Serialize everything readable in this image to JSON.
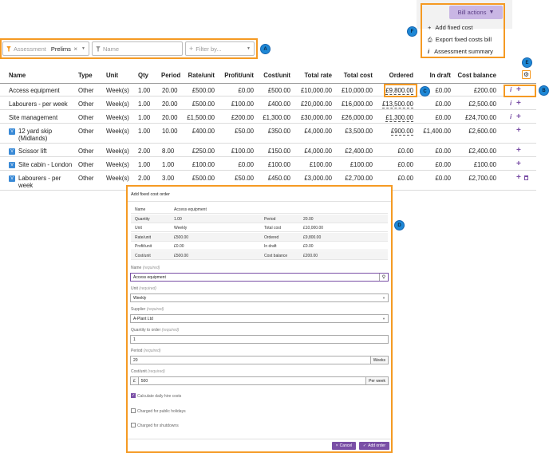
{
  "bill_actions": {
    "button_label": "Bill actions",
    "items": [
      {
        "icon": "plus-icon",
        "label": "Add fixed cost"
      },
      {
        "icon": "print-icon",
        "label": "Export fixed costs bill"
      },
      {
        "icon": "info-icon",
        "label": "Assessment summary"
      }
    ]
  },
  "filters": {
    "assessment_label": "Assessment",
    "assessment_value": "Prelims",
    "name_placeholder": "Name",
    "filter_by_placeholder": "Filter by..."
  },
  "callouts": [
    "A",
    "B",
    "C",
    "D",
    "E",
    "F"
  ],
  "table": {
    "columns": [
      "Name",
      "Type",
      "Unit",
      "Qty",
      "Period",
      "Rate/unit",
      "Profit/unit",
      "Cost/unit",
      "Total rate",
      "Total cost",
      "Ordered",
      "In draft",
      "Cost balance"
    ],
    "rows": [
      {
        "name": "Access equipment",
        "type": "Other",
        "unit": "Week(s)",
        "qty": "1.00",
        "period": "20.00",
        "rate": "£500.00",
        "profit": "£0.00",
        "cost": "£500.00",
        "total_rate": "£10,000.00",
        "total_cost": "£10,000.00",
        "ordered": "£9,800.00",
        "draft": "£0.00",
        "balance": "£200.00"
      },
      {
        "name": "Labourers - per week",
        "type": "Other",
        "unit": "Week(s)",
        "qty": "1.00",
        "period": "20.00",
        "rate": "£500.00",
        "profit": "£100.00",
        "cost": "£400.00",
        "total_rate": "£20,000.00",
        "total_cost": "£16,000.00",
        "ordered": "£13,500.00",
        "draft": "£0.00",
        "balance": "£2,500.00"
      },
      {
        "name": "Site management",
        "type": "Other",
        "unit": "Week(s)",
        "qty": "1.00",
        "period": "20.00",
        "rate": "£1,500.00",
        "profit": "£200.00",
        "cost": "£1,300.00",
        "total_rate": "£30,000.00",
        "total_cost": "£26,000.00",
        "ordered": "£1,300.00",
        "draft": "£0.00",
        "balance": "£24,700.00"
      },
      {
        "name": "12 yard skip (Midlands)",
        "type": "Other",
        "unit": "Week(s)",
        "qty": "1.00",
        "period": "10.00",
        "rate": "£400.00",
        "profit": "£50.00",
        "cost": "£350.00",
        "total_rate": "£4,000.00",
        "total_cost": "£3,500.00",
        "ordered": "£900.00",
        "draft": "£1,400.00",
        "balance": "£2,600.00"
      },
      {
        "name": "Scissor lift",
        "type": "Other",
        "unit": "Week(s)",
        "qty": "2.00",
        "period": "8.00",
        "rate": "£250.00",
        "profit": "£100.00",
        "cost": "£150.00",
        "total_rate": "£4,000.00",
        "total_cost": "£2,400.00",
        "ordered": "£0.00",
        "draft": "£0.00",
        "balance": "£2,400.00"
      },
      {
        "name": "Site cabin - London",
        "type": "Other",
        "unit": "Week(s)",
        "qty": "1.00",
        "period": "1.00",
        "rate": "£100.00",
        "profit": "£0.00",
        "cost": "£100.00",
        "total_rate": "£100.00",
        "total_cost": "£100.00",
        "ordered": "£0.00",
        "draft": "£0.00",
        "balance": "£100.00"
      },
      {
        "name": "Labourers - per week",
        "type": "Other",
        "unit": "Week(s)",
        "qty": "2.00",
        "period": "3.00",
        "rate": "£500.00",
        "profit": "£50.00",
        "cost": "£450.00",
        "total_rate": "£3,000.00",
        "total_cost": "£2,700.00",
        "ordered": "£0.00",
        "draft": "£0.00",
        "balance": "£2,700.00"
      }
    ]
  },
  "dialog": {
    "title": "Add fixed cost order",
    "summary": {
      "name_label": "Name",
      "name_value": "Access equipment",
      "quantity_label": "Quantity",
      "quantity_value": "1.00",
      "period_label": "Period",
      "period_value": "20.00",
      "unit_label": "Unit",
      "unit_value": "Weekly",
      "total_cost_label": "Total cost",
      "total_cost_value": "£10,000.00",
      "rate_label": "Rate/unit",
      "rate_value": "£500.00",
      "ordered_label": "Ordered",
      "ordered_value": "£9,800.00",
      "profit_label": "Profit/unit",
      "profit_value": "£0.00",
      "draft_label": "In draft",
      "draft_value": "£0.00",
      "cost_label": "Cost/unit",
      "cost_value": "£500.00",
      "balance_label": "Cost balance",
      "balance_value": "£200.00"
    },
    "required_tag": "(required)",
    "fields": {
      "name_label": "Name",
      "name_value": "Access equipment",
      "unit_label": "Unit",
      "unit_value": "Weekly",
      "supplier_label": "Supplier",
      "supplier_value": "A-Plant Ltd",
      "qty_label": "Quantity to order",
      "qty_value": "1",
      "period_label": "Period",
      "period_value": "20",
      "period_suffix": "Weeks",
      "costunit_label": "Cost/unit",
      "costunit_prefix": "£",
      "costunit_value": "500",
      "costunit_suffix": "Per week"
    },
    "checkboxes": {
      "daily_hire": "Calculate daily hire costs",
      "public_holidays": "Charged for public holidays",
      "shutdowns": "Charged for shutdowns"
    },
    "cancel_label": "Cancel",
    "add_label": "Add order"
  },
  "colors": {
    "accent": "#f59a23",
    "purple": "#7a4fa6",
    "badge": "#1e88d6"
  }
}
